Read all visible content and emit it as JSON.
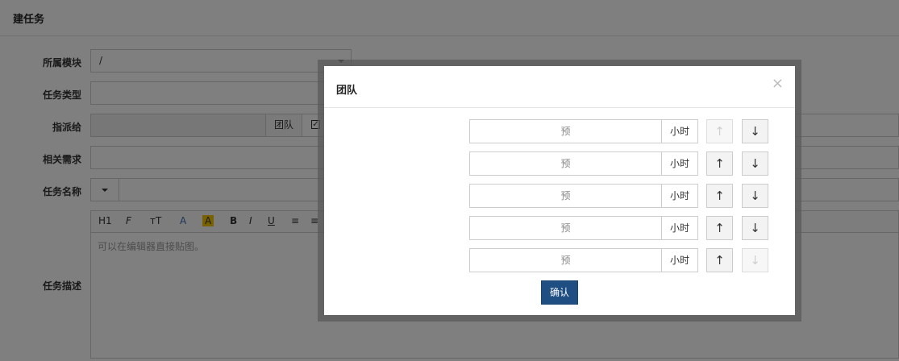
{
  "page": {
    "title": "建任务"
  },
  "form": {
    "module_label": "所属模块",
    "module_value": "/",
    "type_label": "任务类型",
    "assign_label": "指派给",
    "team_addon": "团队",
    "story_label": "相关需求",
    "name_label": "任务名称",
    "desc_label": "任务描述",
    "editor_placeholder": "可以在编辑器直接贴图。",
    "toolbar": [
      "H1",
      "F",
      "тT",
      "A",
      "A",
      "B",
      "I",
      "U",
      "≡",
      "≡"
    ]
  },
  "modal": {
    "title": "团队",
    "close_label": "×",
    "estimate_placeholder": "预",
    "hour_label": "小时",
    "up_arrow": "↑",
    "down_arrow": "↓",
    "confirm_label": "确认",
    "rows": [
      {
        "up_enabled": false,
        "down_enabled": true
      },
      {
        "up_enabled": true,
        "down_enabled": true
      },
      {
        "up_enabled": true,
        "down_enabled": true
      },
      {
        "up_enabled": true,
        "down_enabled": true
      },
      {
        "up_enabled": true,
        "down_enabled": false
      }
    ]
  }
}
